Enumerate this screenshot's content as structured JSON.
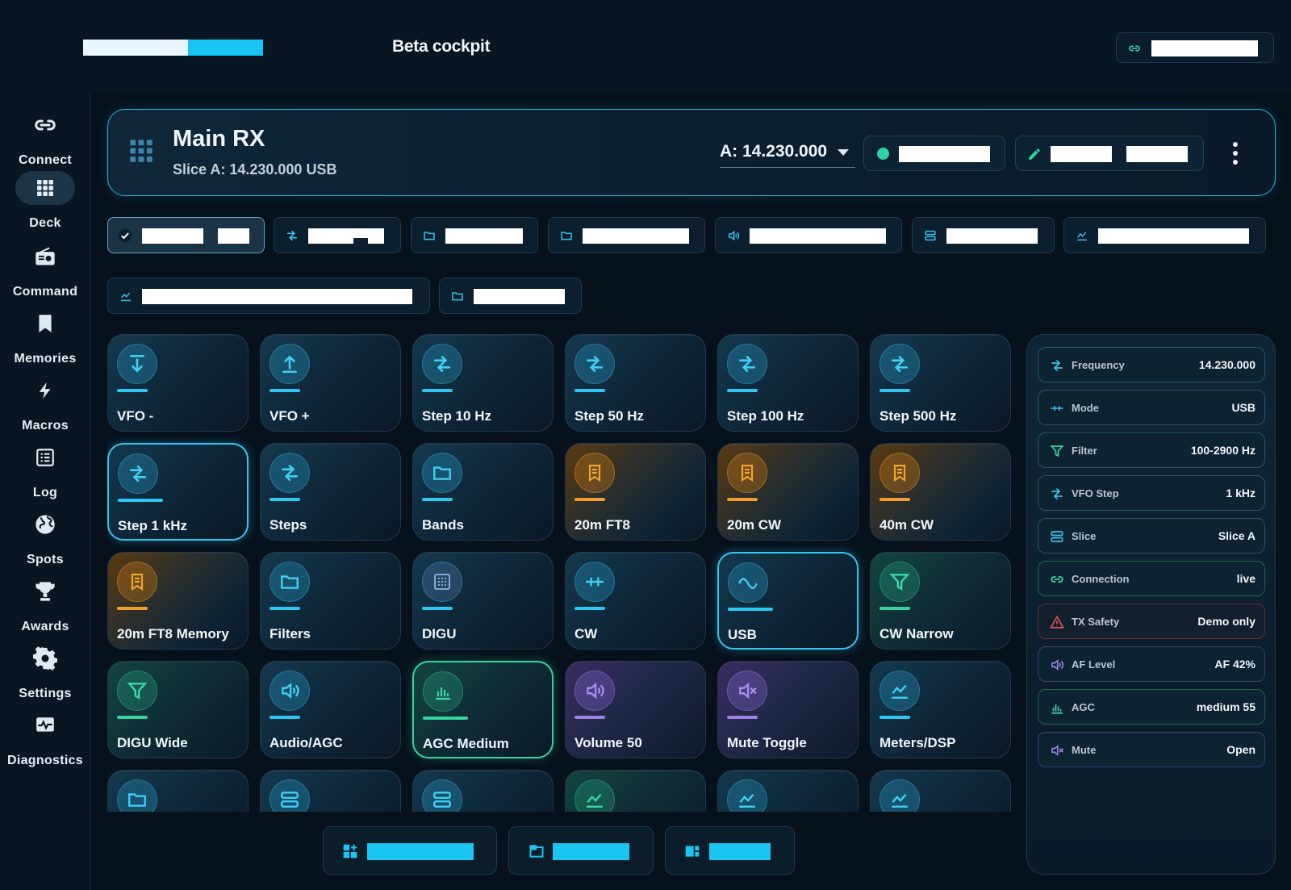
{
  "header": {
    "title": "Beta cockpit"
  },
  "sidebar": {
    "items": [
      {
        "label": "Connect",
        "icon": "link-icon"
      },
      {
        "label": "Deck",
        "icon": "grid-icon",
        "active": true
      },
      {
        "label": "Command",
        "icon": "radio-icon"
      },
      {
        "label": "Memories",
        "icon": "bookmark-icon"
      },
      {
        "label": "Macros",
        "icon": "bolt-icon"
      },
      {
        "label": "Log",
        "icon": "list-icon"
      },
      {
        "label": "Spots",
        "icon": "globe-icon"
      },
      {
        "label": "Awards",
        "icon": "trophy-icon"
      },
      {
        "label": "Settings",
        "icon": "gear-icon"
      },
      {
        "label": "Diagnostics",
        "icon": "monitor-icon"
      }
    ]
  },
  "rx": {
    "title": "Main RX",
    "subtitle": "Slice A: 14.230.000 USB",
    "vfo_value": "A: 14.230.000"
  },
  "tiles": [
    {
      "label": "VFO -",
      "icon": "arrow-down-icon",
      "tone": "cyan"
    },
    {
      "label": "VFO +",
      "icon": "arrow-up-icon",
      "tone": "cyan"
    },
    {
      "label": "Step 10 Hz",
      "icon": "swap-icon",
      "tone": "cyan"
    },
    {
      "label": "Step 50 Hz",
      "icon": "swap-icon",
      "tone": "cyan"
    },
    {
      "label": "Step 100 Hz",
      "icon": "swap-icon",
      "tone": "cyan"
    },
    {
      "label": "Step 500 Hz",
      "icon": "swap-icon",
      "tone": "cyan"
    },
    {
      "label": "Step 1 kHz",
      "icon": "swap-icon",
      "tone": "cyan",
      "selected": "cyan"
    },
    {
      "label": "Steps",
      "icon": "swap-icon",
      "tone": "cyan"
    },
    {
      "label": "Bands",
      "icon": "folder-icon",
      "tone": "cyan"
    },
    {
      "label": "20m FT8",
      "icon": "bookmark-icon",
      "tone": "orange"
    },
    {
      "label": "20m CW",
      "icon": "bookmark-icon",
      "tone": "orange"
    },
    {
      "label": "40m CW",
      "icon": "bookmark-icon",
      "tone": "orange"
    },
    {
      "label": "20m FT8 Memory",
      "icon": "bookmark-icon",
      "tone": "orange"
    },
    {
      "label": "Filters",
      "icon": "folder-icon",
      "tone": "cyan"
    },
    {
      "label": "DIGU",
      "icon": "keypad-icon",
      "tone": "cyan"
    },
    {
      "label": "CW",
      "icon": "cw-icon",
      "tone": "cyan"
    },
    {
      "label": "USB",
      "icon": "wave-icon",
      "tone": "cyan",
      "selected": "cyan"
    },
    {
      "label": "CW Narrow",
      "icon": "filter-icon",
      "tone": "green"
    },
    {
      "label": "DIGU Wide",
      "icon": "filter-icon",
      "tone": "green"
    },
    {
      "label": "Audio/AGC",
      "icon": "speaker-icon",
      "tone": "cyan"
    },
    {
      "label": "AGC Medium",
      "icon": "bars-icon",
      "tone": "green",
      "selected": "green"
    },
    {
      "label": "Volume 50",
      "icon": "speaker-icon",
      "tone": "purple"
    },
    {
      "label": "Mute Toggle",
      "icon": "mute-icon",
      "tone": "purple"
    },
    {
      "label": "Meters/DSP",
      "icon": "chart-icon",
      "tone": "cyan"
    },
    {
      "label": "",
      "icon": "folder-icon",
      "tone": "cyan"
    },
    {
      "label": "",
      "icon": "server-icon",
      "tone": "cyan"
    },
    {
      "label": "",
      "icon": "server-icon",
      "tone": "cyan"
    },
    {
      "label": "",
      "icon": "chart-icon",
      "tone": "green"
    },
    {
      "label": "",
      "icon": "chart-icon",
      "tone": "cyan"
    },
    {
      "label": "",
      "icon": "chart-icon",
      "tone": "cyan"
    }
  ],
  "status": [
    {
      "key": "Frequency",
      "value": "14.230.000",
      "icon": "swap-icon",
      "tone": "cyan"
    },
    {
      "key": "Mode",
      "value": "USB",
      "icon": "cw-icon",
      "tone": "cyan"
    },
    {
      "key": "Filter",
      "value": "100-2900 Hz",
      "icon": "filter-icon",
      "tone": "cyan"
    },
    {
      "key": "VFO Step",
      "value": "1 kHz",
      "icon": "swap-icon",
      "tone": "cyan"
    },
    {
      "key": "Slice",
      "value": "Slice A",
      "icon": "server-icon",
      "tone": "cyan"
    },
    {
      "key": "Connection",
      "value": "live",
      "icon": "link-icon",
      "tone": "green"
    },
    {
      "key": "TX Safety",
      "value": "Demo only",
      "icon": "warning-icon",
      "tone": "red"
    },
    {
      "key": "AF Level",
      "value": "AF 42%",
      "icon": "speaker-icon",
      "tone": "purple"
    },
    {
      "key": "AGC",
      "value": "medium 55",
      "icon": "bars-icon",
      "tone": "green"
    },
    {
      "key": "Mute",
      "value": "Open",
      "icon": "mute-icon",
      "tone": "purple"
    }
  ],
  "colors": {
    "accent_cyan": "#19c6f2",
    "accent_green": "#36d39f",
    "accent_orange": "#f0a02a",
    "accent_purple": "#9b82e6",
    "danger": "#e0505f",
    "background": "#07111c"
  }
}
